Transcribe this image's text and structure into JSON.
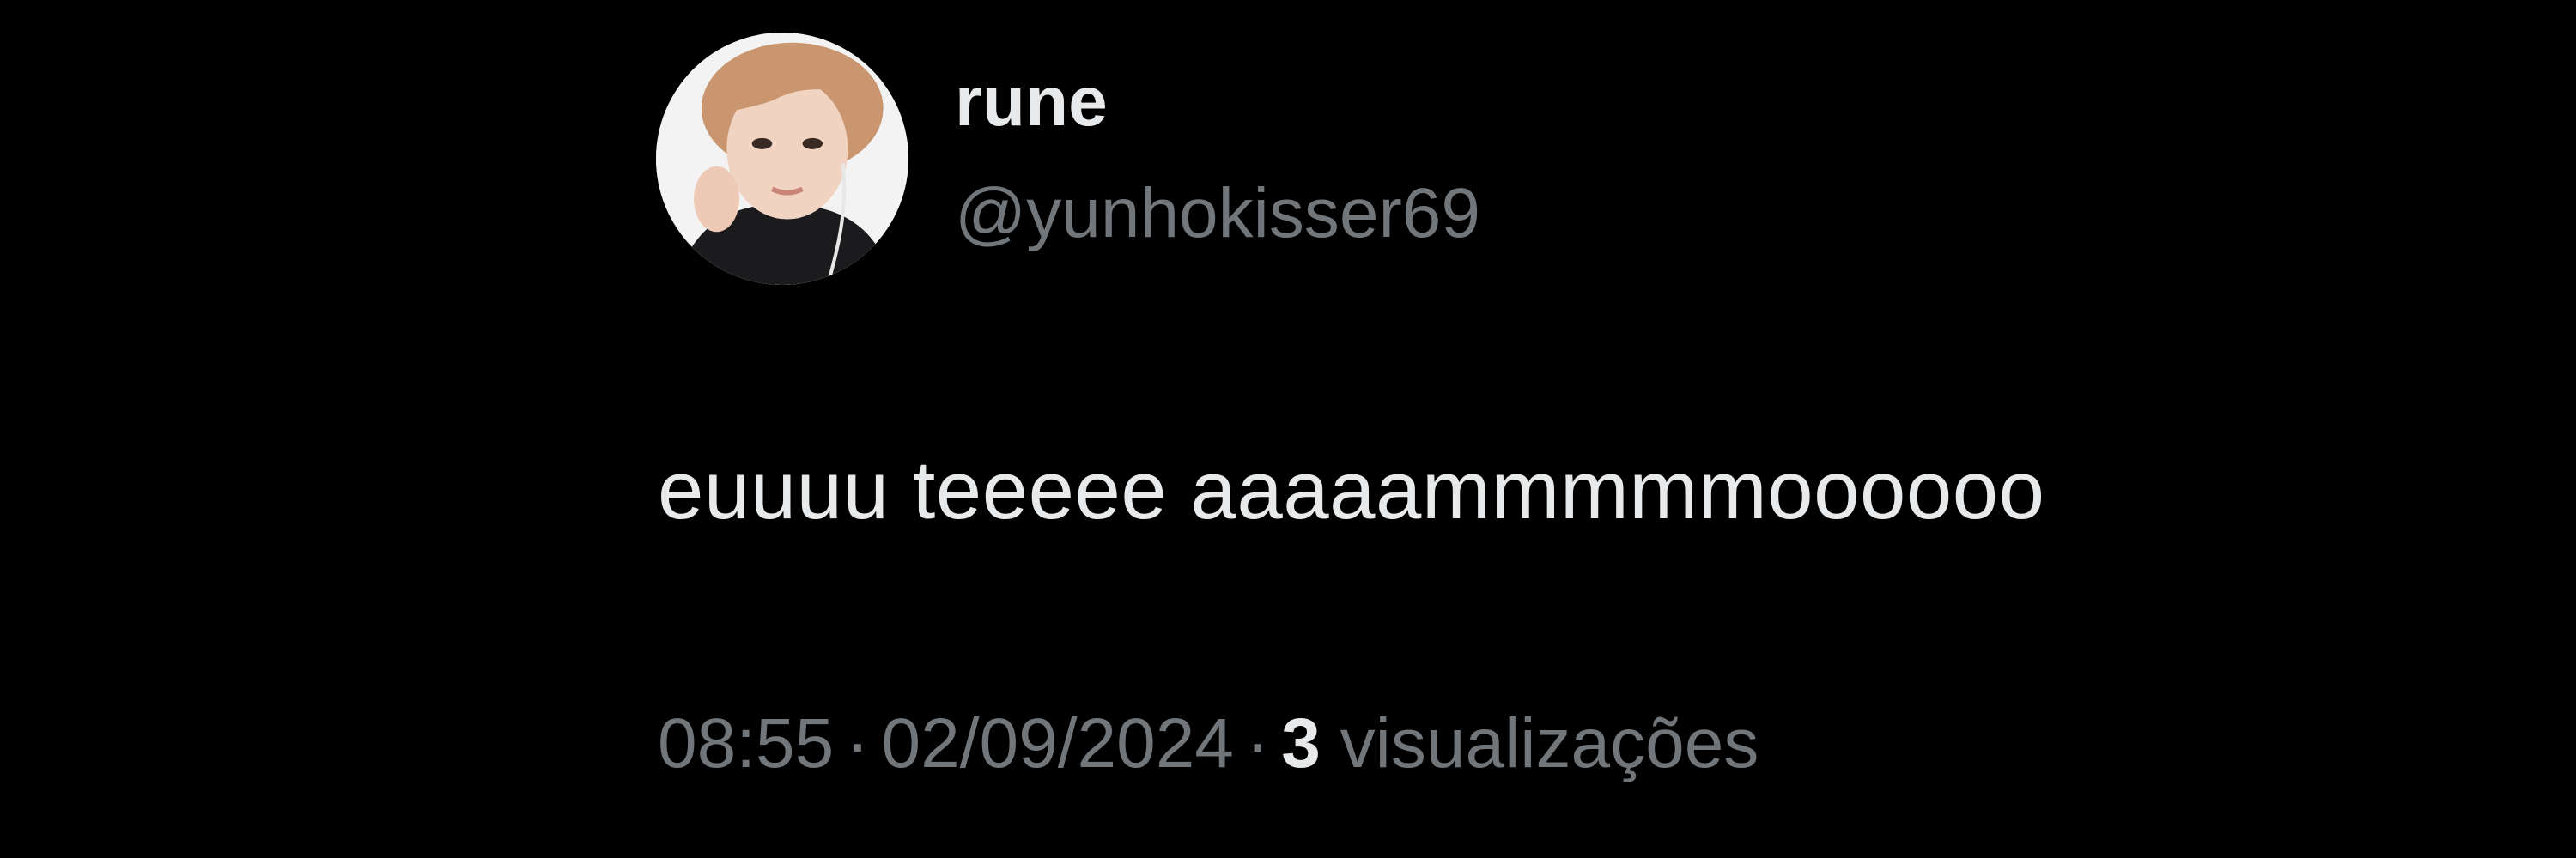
{
  "tweet": {
    "author": {
      "display_name": "rune",
      "handle": "@yunhokisser69",
      "avatar_icon": "profile-photo"
    },
    "text": "euuuu teeeee aaaaammmmmoooooo",
    "time": "08:55",
    "date": "02/09/2024",
    "separator": "·",
    "views_count": "3",
    "views_label": "visualizações"
  },
  "colors": {
    "background": "#000000",
    "primary_text": "#e7e9ea",
    "secondary_text": "#71767b"
  }
}
